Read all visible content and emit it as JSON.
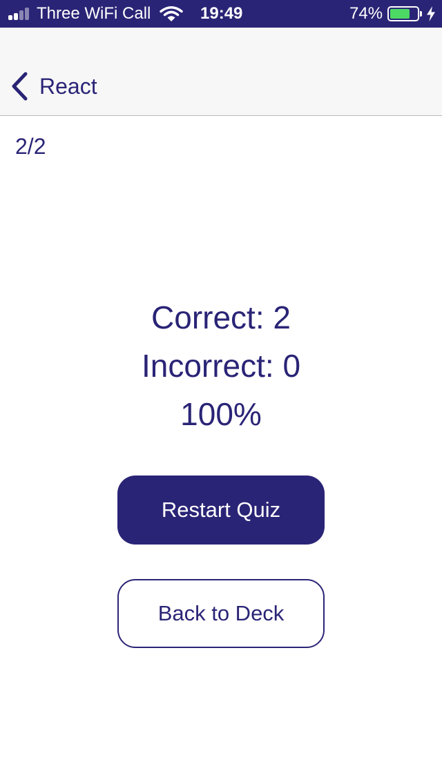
{
  "status_bar": {
    "carrier": "Three WiFi Call",
    "time": "19:49",
    "battery_percent": "74%",
    "battery_level": 0.74,
    "signal_bars_filled": 2,
    "signal_bars_total": 4,
    "icons": [
      "signal-icon",
      "wifi-icon",
      "battery-icon",
      "charging-bolt-icon"
    ],
    "background_color": "#2a2476",
    "battery_fill_color": "#4cd964"
  },
  "nav": {
    "back_label": "React",
    "back_icon": "chevron-left-icon"
  },
  "quiz": {
    "progress": "2/2",
    "correct": "Correct: 2",
    "incorrect": "Incorrect: 0",
    "score": "100%"
  },
  "actions": {
    "restart_label": "Restart Quiz",
    "back_to_deck_label": "Back to Deck"
  },
  "colors": {
    "primary": "#2a2476",
    "nav_background": "#f7f7f7",
    "divider": "#b8b8b8"
  }
}
